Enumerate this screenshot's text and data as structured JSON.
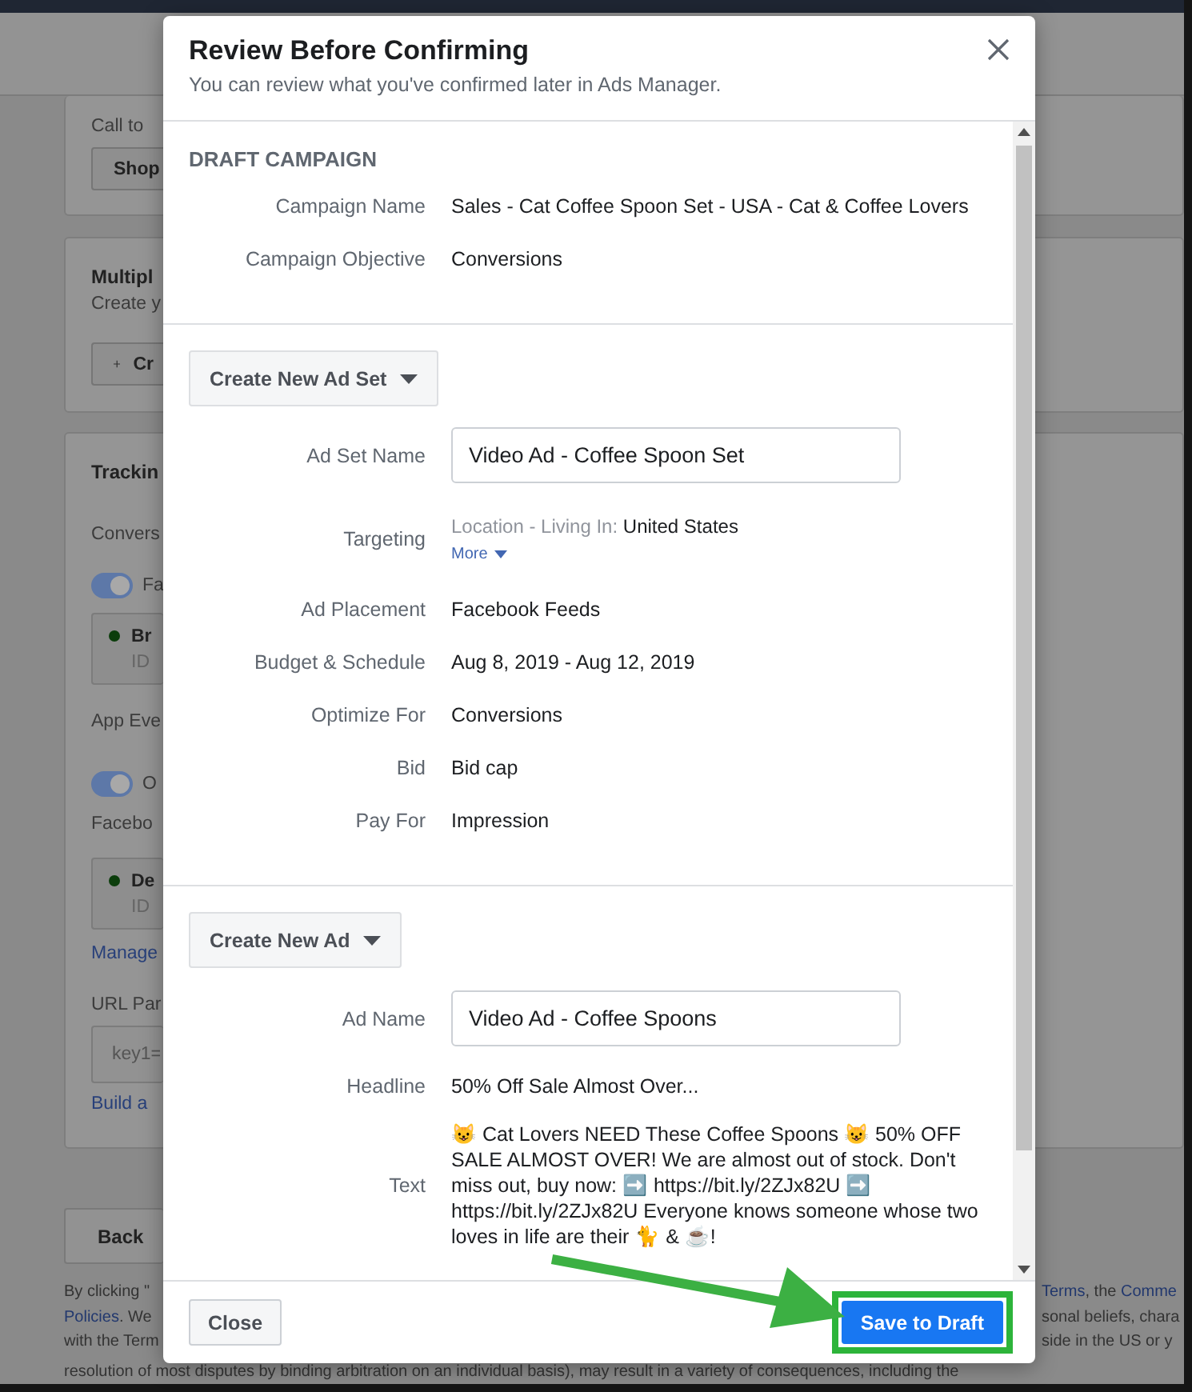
{
  "background_page": {
    "cards": [
      {
        "items": [
          {
            "kind": "label",
            "text": "Call to"
          },
          {
            "kind": "button",
            "text": "Shop"
          }
        ]
      },
      {
        "items": [
          {
            "kind": "heading",
            "text": "Multipl"
          },
          {
            "kind": "label",
            "text": "Create y"
          },
          {
            "kind": "add-button",
            "text": "Cr"
          }
        ]
      },
      {
        "items": [
          {
            "kind": "heading",
            "text": "Trackin"
          },
          {
            "kind": "label",
            "text": "Convers"
          },
          {
            "kind": "toggle",
            "on": true,
            "text": "Fa"
          },
          {
            "kind": "status-box",
            "title": "Br",
            "subtitle": "ID"
          },
          {
            "kind": "label",
            "text": "App Eve"
          },
          {
            "kind": "toggle",
            "on": true,
            "text": "O"
          },
          {
            "kind": "label",
            "text": "Facebo"
          },
          {
            "kind": "status-box",
            "title": "De",
            "subtitle": "ID"
          },
          {
            "kind": "link",
            "text": "Manage"
          },
          {
            "kind": "label",
            "text": "URL Par"
          },
          {
            "kind": "input",
            "text": "key1="
          },
          {
            "kind": "link",
            "text": "Build a"
          }
        ]
      }
    ],
    "back_button": "Back",
    "legal_left": [
      [
        {
          "kind": "text",
          "text": "By clicking \""
        }
      ],
      [
        {
          "kind": "link",
          "text": "Policies"
        },
        {
          "kind": "text",
          "text": ". We"
        }
      ],
      [
        {
          "kind": "text",
          "text": "with the Term"
        }
      ]
    ],
    "legal_right": [
      [
        {
          "kind": "link",
          "text": "Terms"
        },
        {
          "kind": "text",
          "text": ", the "
        },
        {
          "kind": "link",
          "text": "Comme"
        }
      ],
      [
        {
          "kind": "text",
          "text": "sonal beliefs, chara"
        }
      ],
      [
        {
          "kind": "text",
          "text": "side in the US or y"
        }
      ]
    ],
    "legal_full": "resolution of most disputes by binding arbitration on an individual basis), may result in a variety of consequences, including the"
  },
  "modal": {
    "title": "Review Before Confirming",
    "subtitle": "You can review what you've confirmed later in Ads Manager.",
    "sections": [
      {
        "kind": "summary",
        "heading": "DRAFT CAMPAIGN",
        "rows": [
          {
            "kind": "text",
            "label": "Campaign Name",
            "value": "Sales - Cat Coffee Spoon Set - USA - Cat & Coffee Lovers"
          },
          {
            "kind": "text",
            "label": "Campaign Objective",
            "value": "Conversions"
          }
        ]
      },
      {
        "kind": "group",
        "menu_button": "Create New Ad Set",
        "rows": [
          {
            "kind": "input",
            "label": "Ad Set Name",
            "value": "Video Ad - Coffee Spoon Set"
          },
          {
            "kind": "targeting",
            "label": "Targeting",
            "key": "Location - Living In:",
            "value": "United States",
            "more": "More"
          },
          {
            "kind": "text",
            "label": "Ad Placement",
            "value": "Facebook Feeds"
          },
          {
            "kind": "text",
            "label": "Budget & Schedule",
            "value": "Aug 8, 2019 - Aug 12, 2019"
          },
          {
            "kind": "text",
            "label": "Optimize For",
            "value": "Conversions"
          },
          {
            "kind": "text",
            "label": "Bid",
            "value": "Bid cap"
          },
          {
            "kind": "text",
            "label": "Pay For",
            "value": "Impression"
          }
        ]
      },
      {
        "kind": "group",
        "menu_button": "Create New Ad",
        "rows": [
          {
            "kind": "input",
            "label": "Ad Name",
            "value": "Video Ad - Coffee Spoons"
          },
          {
            "kind": "text",
            "label": "Headline",
            "value": "50% Off Sale Almost Over..."
          },
          {
            "kind": "paragraph",
            "label": "Text",
            "value": "😺 Cat Lovers NEED These Coffee Spoons 😺 50% OFF SALE ALMOST OVER! We are almost out of stock. Don't miss out, buy now: ➡️ https://bit.ly/2ZJx82U ➡️ https://bit.ly/2ZJx82U Everyone knows someone whose two loves in life are their 🐈 & ☕!"
          }
        ]
      }
    ],
    "buttons": [
      {
        "kind": "secondary",
        "label": "Close",
        "highlighted": false
      },
      {
        "kind": "primary",
        "label": "Save to Draft",
        "highlighted": true
      }
    ]
  }
}
